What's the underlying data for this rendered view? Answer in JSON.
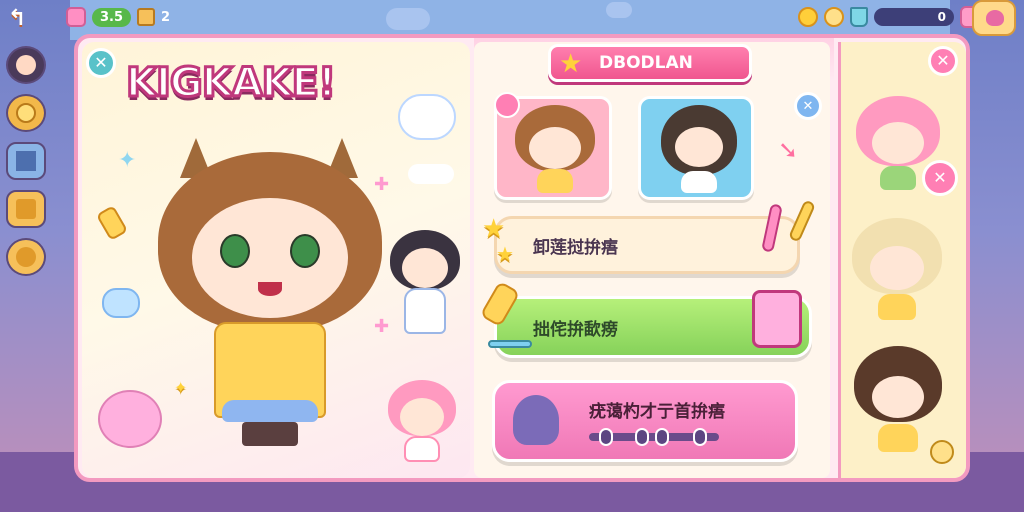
{
  "hud": {
    "currency_value": "3.5",
    "count_a": "2",
    "bar_value": "0",
    "icons": [
      "pink-gem-icon",
      "coin-icon",
      "box-icon",
      "cup-icon",
      "plus-icon",
      "paw-settings-icon"
    ]
  },
  "sidebar": {
    "items": [
      {
        "icon": "avatar-icon",
        "color": "#4a3a5a"
      },
      {
        "icon": "coin-icon",
        "color": "#f2b84a"
      },
      {
        "icon": "book-icon",
        "color": "#8ab4e6"
      },
      {
        "icon": "scroll-icon",
        "color": "#f6c05a"
      },
      {
        "icon": "face-icon",
        "color": "#f6c05a"
      }
    ]
  },
  "logo": {
    "text": "KIGKAKE!"
  },
  "header": {
    "title": "DBODLAN"
  },
  "buttons": {
    "row1_label": "卸莲挝拚痦",
    "row2_label": "拙侘拚歃痨",
    "row3_label": "疣蔼杓才亍首拚痦"
  },
  "colors": {
    "panel_border": "#f39ac0",
    "accent_pink": "#ff7fb4",
    "accent_green": "#86d25a",
    "accent_blue": "#7fb6f0",
    "star": "#ffd23a"
  }
}
